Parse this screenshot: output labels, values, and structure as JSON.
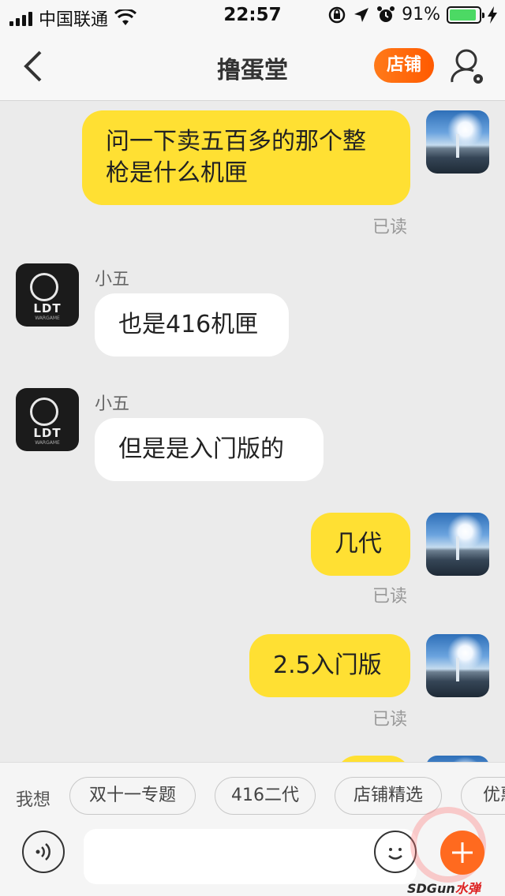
{
  "status_bar": {
    "carrier": "中国联通",
    "time": "22:57",
    "battery_percent": "91%",
    "battery_level": 0.91,
    "battery_color": "#4cd964"
  },
  "nav": {
    "back_icon": "chevron-left",
    "title": "撸蛋堂",
    "shop_button": "店铺",
    "shop_button_color": "#ff6a00",
    "user_icon": "user-settings"
  },
  "messages": [
    {
      "side": "me",
      "text": "问一下卖五百多的那个整枪是什么机匣",
      "status": "已读"
    },
    {
      "side": "them",
      "sender": "小五",
      "text": "也是416机匣"
    },
    {
      "side": "them",
      "sender": "小五",
      "text": "但是是入门版的"
    },
    {
      "side": "me",
      "text": "几代",
      "status": "已读"
    },
    {
      "side": "me",
      "text": "2.5入门版",
      "status": "已读"
    }
  ],
  "shop_avatar": {
    "logo_text": "LDT",
    "logo_sub": "WARGAME"
  },
  "suggestions": {
    "label": "我想",
    "chips": [
      "双十一专题",
      "416二代",
      "店铺精选",
      "优惠"
    ]
  },
  "input": {
    "voice_icon": "voice-wave",
    "placeholder": "",
    "emoji_icon": "smiley",
    "plus_icon": "plus",
    "plus_color": "#ff6a1f"
  },
  "watermark": {
    "text_a": "SDGun",
    "text_b": "水弹"
  },
  "colors": {
    "my_bubble": "#ffe033",
    "their_bubble": "#ffffff",
    "chat_background": "#ebebeb"
  }
}
